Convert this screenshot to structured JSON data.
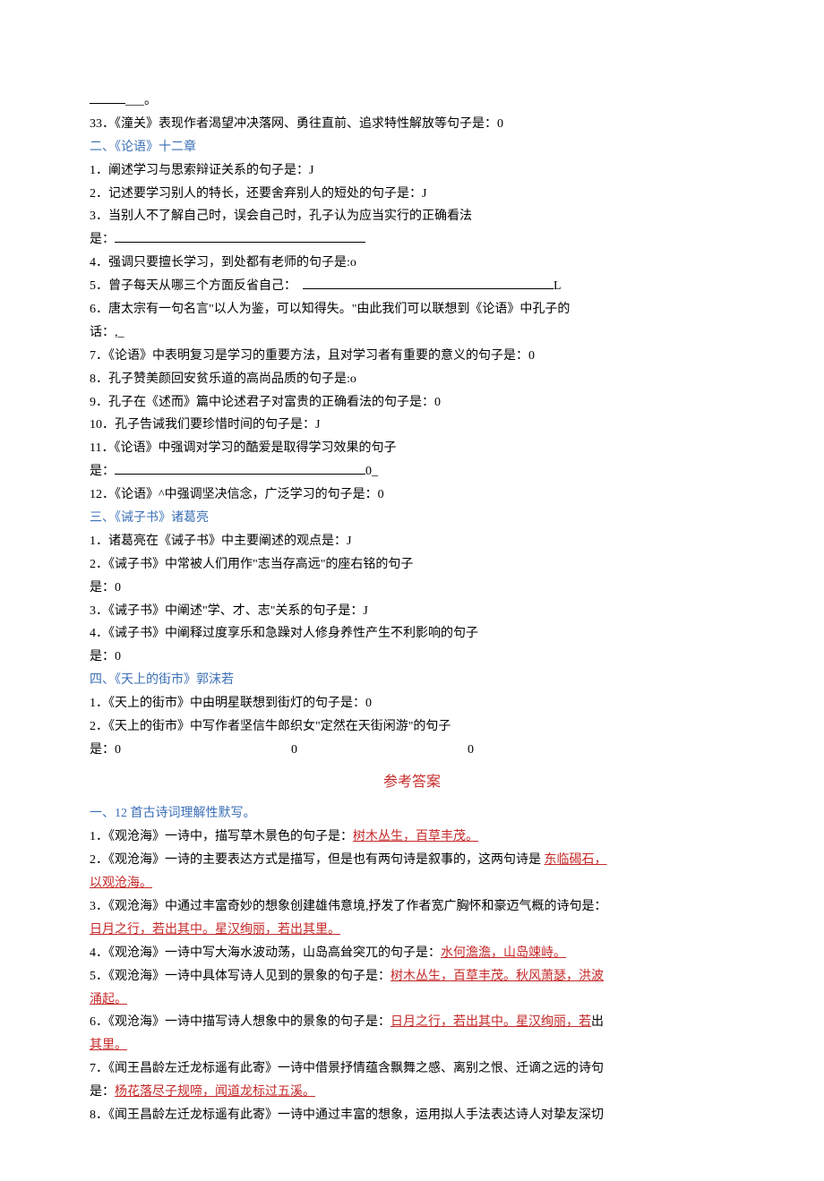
{
  "top": {
    "ellipsis": "___。",
    "q33": "33．《潼关》表现作者渴望冲决落网、勇往直前、追求特性解放等句子是：0"
  },
  "s2": {
    "heading": "二、《论语》十二章",
    "q1": "1．阐述学习与思索辩证关系的句子是：J",
    "q2": "2．记述要学习别人的特长，还要舍弃别人的短处的句子是：J",
    "q3a": "3．当别人不了解自己时，误会自己时，孔子认为应当实行的正确看法",
    "q3b": "是：",
    "q4": "4．强调只要擅长学习，到处都有老师的句子是:o",
    "q5": "5．曾子每天从哪三个方面反省自己：",
    "q5tail": "L",
    "q6a": "6．唐太宗有一句名言\"以人为鉴，可以知得失。\"由此我们可以联想到《论语》中孔子的",
    "q6b": "话：,_",
    "q7": "7．《论语》中表明复习是学习的重要方法，且对学习者有重要的意义的句子是：0",
    "q8": "8．孔子赞美颜回安贫乐道的高尚品质的句子是:o",
    "q9": "9．孔子在《述而》篇中论述君子对富贵的正确看法的句子是：0",
    "q10": "10．孔子告诫我们要珍惜时间的句子是：J",
    "q11a": "11．《论语》中强调对学习的酷爱是取得学习效果的句子",
    "q11b_pre": "是：",
    "q11b_suf": "0_",
    "q12": "12．《论语》^中强调坚决信念，广泛学习的句子是：0"
  },
  "s3": {
    "heading": "三、《诫子书》诸葛亮",
    "q1": "1．诸葛亮在《诫子书》中主要阐述的观点是：J",
    "q2a": "2．《诫子书》中常被人们用作\"志当存高远\"的座右铭的句子",
    "q2b": "是：0",
    "q3": "3．《诫子书》中阐述\"学、才、志\"关系的句子是：J",
    "q4a": "4．《诫子书》中阐释过度享乐和急躁对人修身养性产生不利影响的句子",
    "q4b": "是：0"
  },
  "s4": {
    "heading": "四、《天上的街市》郭沫若",
    "q1": "1．《天上的街市》中由明星联想到街灯的句子是：0",
    "q2a": "2．《天上的街市》中写作者坚信牛郎织女\"定然在天街闲游\"的句子",
    "q2b_1": "是：0",
    "q2b_2": "0",
    "q2b_3": "0"
  },
  "answers": {
    "title": "参考答案",
    "heading": "一、12 首古诗词理解性默写。",
    "a1_pre": "1．《观沧海》一诗中，描写草木景色的句子是：",
    "a1_ans": "树木丛生，百草丰茂。",
    "a2_pre": "2．《观沧海》一诗的主要表达方式是描写，但是也有两句诗是叙事的，这两句诗是 ",
    "a2_ans": "东临碣石，",
    "a2_ans2": "以观沧海。",
    "a3_pre": "3．《观沧海》中通过丰富奇妙的想象创建雄伟意境,抒发了作者宽广胸怀和豪迈气概的诗句是：",
    "a3_ans": "日月之行，若出其中。星汉绚丽，若出其里。",
    "a4_pre": "4．《观沧海》一诗中写大海水波动荡，山岛高耸突兀的句子是：",
    "a4_ans": "水何澹澹，山岛竦峙。",
    "a5_pre": "5．《观沧海》一诗中具体写诗人见到的景象的句子是：",
    "a5_ans": "树木丛生，百草丰茂。秋风萧瑟，洪波",
    "a5_ans2": "涌起。",
    "a6_pre": "6．《观沧海》一诗中描写诗人想象中的景象的句子是：",
    "a6_ans": "日月之行，若出其中。星汉绚丽，若",
    "a6_suf": "出",
    "a6_ans2": "其里。",
    "a7_pre": "7．《闻王昌龄左迁龙标遥有此寄》一诗中借景抒情蕴含飘舞之感、离别之恨、迁谪之远的诗句",
    "a7_pre2": "是：",
    "a7_ans": "杨花落尽子规啼，闻道龙标过五溪。",
    "a8": "8．《闻王昌龄左迁龙标遥有此寄》一诗中通过丰富的想象，运用拟人手法表达诗人对挚友深切"
  }
}
